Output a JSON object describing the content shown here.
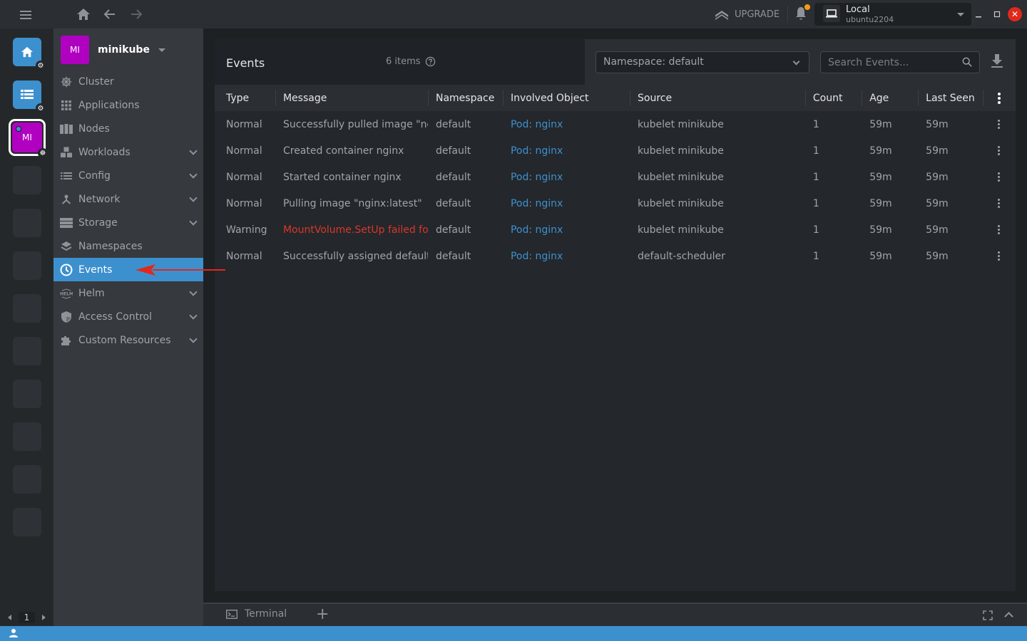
{
  "topbar": {
    "upgrade_label": "UPGRADE",
    "context": {
      "name": "Local",
      "host": "ubuntu2204"
    }
  },
  "hotbar": {
    "active_cluster_initials": "MI",
    "page": "1"
  },
  "sidebar": {
    "cluster_initials": "MI",
    "cluster_name": "minikube",
    "items": [
      {
        "label": "Cluster",
        "icon": "helm-wheel-icon",
        "expandable": false
      },
      {
        "label": "Applications",
        "icon": "grid-icon",
        "expandable": false
      },
      {
        "label": "Nodes",
        "icon": "nodes-icon",
        "expandable": false
      },
      {
        "label": "Workloads",
        "icon": "cubes-icon",
        "expandable": true
      },
      {
        "label": "Config",
        "icon": "list-icon",
        "expandable": true
      },
      {
        "label": "Network",
        "icon": "network-icon",
        "expandable": true
      },
      {
        "label": "Storage",
        "icon": "storage-icon",
        "expandable": true
      },
      {
        "label": "Namespaces",
        "icon": "layers-icon",
        "expandable": false
      },
      {
        "label": "Events",
        "icon": "clock-icon",
        "expandable": false,
        "active": true
      },
      {
        "label": "Helm",
        "icon": "helm-icon",
        "expandable": true
      },
      {
        "label": "Access Control",
        "icon": "shield-icon",
        "expandable": true
      },
      {
        "label": "Custom Resources",
        "icon": "puzzle-icon",
        "expandable": true
      }
    ]
  },
  "events": {
    "title": "Events",
    "count_label": "6 items",
    "namespace_filter": "Namespace: default",
    "search_placeholder": "Search Events...",
    "columns": [
      "Type",
      "Message",
      "Namespace",
      "Involved Object",
      "Source",
      "Count",
      "Age",
      "Last Seen"
    ],
    "rows": [
      {
        "type": "Normal",
        "message": "Successfully pulled image \"nginx:latest\"",
        "namespace": "default",
        "object": "Pod: nginx",
        "source": "kubelet minikube",
        "count": "1",
        "age": "59m",
        "last_seen": "59m",
        "warning": false
      },
      {
        "type": "Normal",
        "message": "Created container nginx",
        "namespace": "default",
        "object": "Pod: nginx",
        "source": "kubelet minikube",
        "count": "1",
        "age": "59m",
        "last_seen": "59m",
        "warning": false
      },
      {
        "type": "Normal",
        "message": "Started container nginx",
        "namespace": "default",
        "object": "Pod: nginx",
        "source": "kubelet minikube",
        "count": "1",
        "age": "59m",
        "last_seen": "59m",
        "warning": false
      },
      {
        "type": "Normal",
        "message": "Pulling image \"nginx:latest\"",
        "namespace": "default",
        "object": "Pod: nginx",
        "source": "kubelet minikube",
        "count": "1",
        "age": "59m",
        "last_seen": "59m",
        "warning": false
      },
      {
        "type": "Warning",
        "message": "MountVolume.SetUp failed for volume",
        "namespace": "default",
        "object": "Pod: nginx",
        "source": "kubelet minikube",
        "count": "1",
        "age": "59m",
        "last_seen": "59m",
        "warning": true
      },
      {
        "type": "Normal",
        "message": "Successfully assigned default/nginx",
        "namespace": "default",
        "object": "Pod: nginx",
        "source": "default-scheduler",
        "count": "1",
        "age": "59m",
        "last_seen": "59m",
        "warning": false
      }
    ]
  },
  "dock": {
    "terminal_label": "Terminal"
  },
  "colors": {
    "accent": "#3d90ce",
    "cluster": "#b000c0",
    "warning": "#d9372b",
    "notification": "#f39c12"
  }
}
